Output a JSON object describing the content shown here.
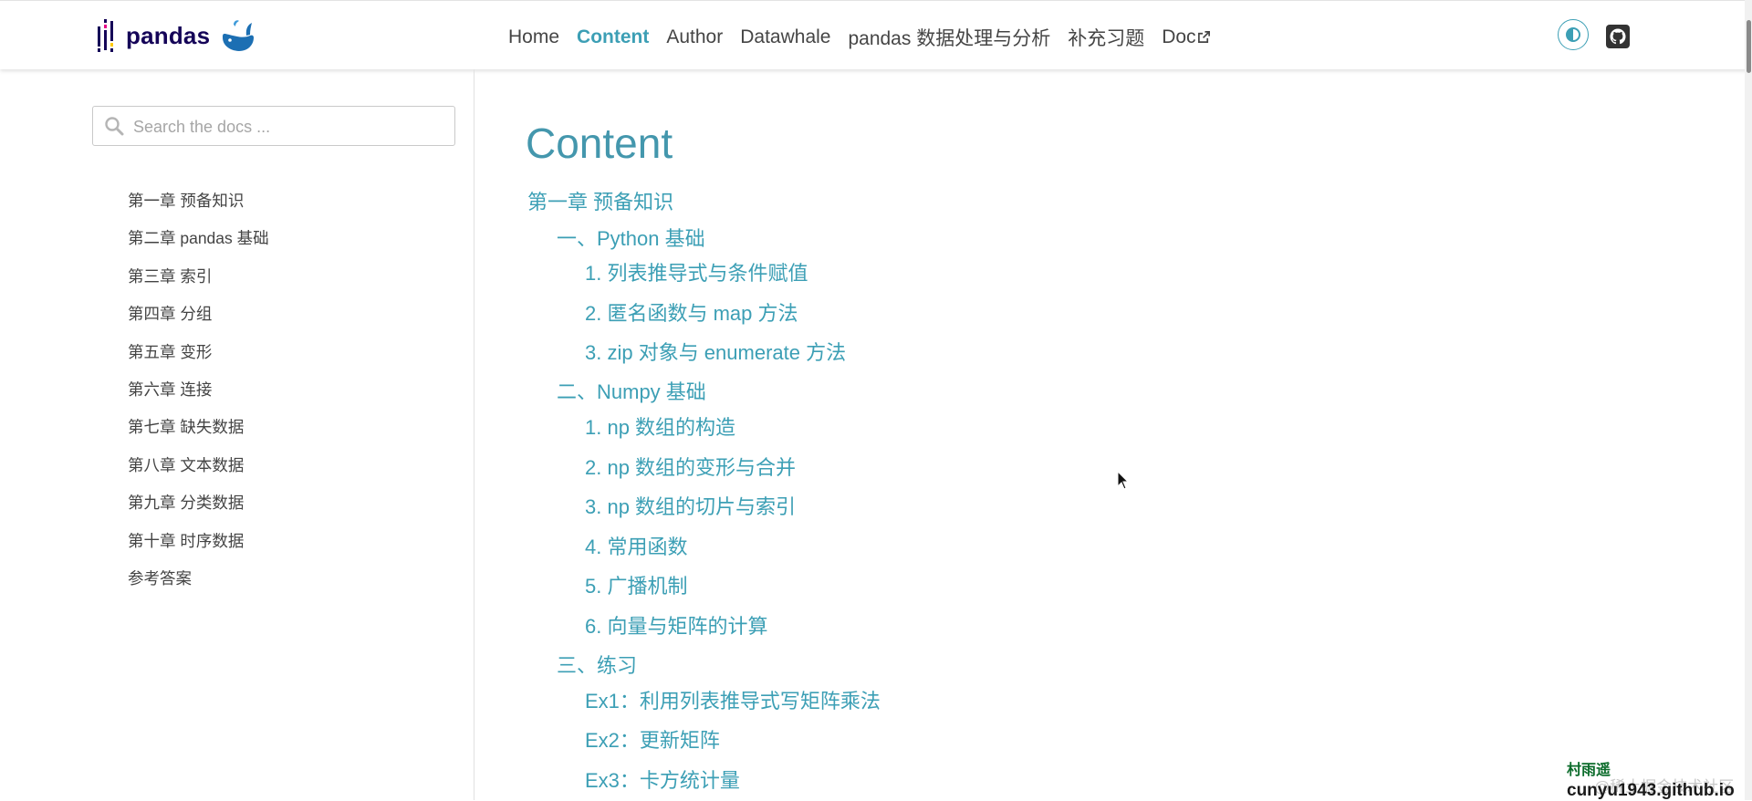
{
  "brand": {
    "name": "pandas"
  },
  "nav": {
    "links": [
      {
        "label": "Home"
      },
      {
        "label": "Content",
        "active": true
      },
      {
        "label": "Author"
      },
      {
        "label": "Datawhale"
      },
      {
        "label": "pandas 数据处理与分析"
      },
      {
        "label": "补充习题"
      },
      {
        "label": "Doc"
      }
    ]
  },
  "search": {
    "placeholder": "Search the docs ..."
  },
  "sidebar": {
    "items": [
      {
        "label": "第一章 预备知识"
      },
      {
        "label": "第二章 pandas 基础"
      },
      {
        "label": "第三章 索引"
      },
      {
        "label": "第四章 分组"
      },
      {
        "label": "第五章 变形"
      },
      {
        "label": "第六章 连接"
      },
      {
        "label": "第七章 缺失数据"
      },
      {
        "label": "第八章 文本数据"
      },
      {
        "label": "第九章 分类数据"
      },
      {
        "label": "第十章 时序数据"
      },
      {
        "label": "参考答案"
      }
    ]
  },
  "main": {
    "title": "Content",
    "toc": [
      {
        "label": "第一章 预备知识",
        "level": 1
      },
      {
        "label": "一、Python 基础",
        "level": 2
      },
      {
        "label": "1. 列表推导式与条件赋值",
        "level": 3
      },
      {
        "label": "2. 匿名函数与 map 方法",
        "level": 3
      },
      {
        "label": "3. zip 对象与 enumerate 方法",
        "level": 3
      },
      {
        "label": "二、Numpy 基础",
        "level": 2
      },
      {
        "label": "1. np 数组的构造",
        "level": 3
      },
      {
        "label": "2. np 数组的变形与合并",
        "level": 3
      },
      {
        "label": "3. np 数组的切片与索引",
        "level": 3
      },
      {
        "label": "4. 常用函数",
        "level": 3
      },
      {
        "label": "5. 广播机制",
        "level": 3
      },
      {
        "label": "6. 向量与矩阵的计算",
        "level": 3
      },
      {
        "label": "三、练习",
        "level": 2
      },
      {
        "label": "Ex1：利用列表推导式写矩阵乘法",
        "level": 3
      },
      {
        "label": "Ex2：更新矩阵",
        "level": 3
      },
      {
        "label": "Ex3：卡方统计量",
        "level": 3
      }
    ]
  },
  "watermark": {
    "line1": "村雨遥",
    "line2": "cunyu1943.github.io",
    "ghost": "@稀土掘金技术社区"
  },
  "colors": {
    "accent": "#3c9fb5",
    "title": "#4497ad",
    "brand": "#150458",
    "text": "#444444"
  },
  "icons": [
    "pandas-logo-icon",
    "whale-icon",
    "external-link-icon",
    "theme-toggle-icon",
    "github-icon",
    "search-icon",
    "mouse-cursor-icon"
  ]
}
